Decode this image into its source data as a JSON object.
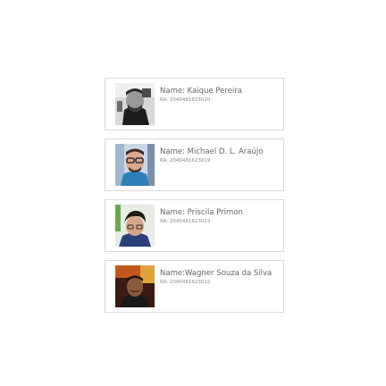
{
  "students": [
    {
      "name_text": "Name: Kaique Pereira",
      "ra_text": "RA: 2040481623020",
      "avatar_icon": "student-photo-icon",
      "photo_tone": "grayscale"
    },
    {
      "name_text": "Name: Michael D. L. Araújo",
      "ra_text": "RA: 2040481623019",
      "avatar_icon": "student-photo-icon",
      "photo_tone": "color"
    },
    {
      "name_text": "Name: Priscila Primon",
      "ra_text": "RA: 2040481623023",
      "avatar_icon": "student-photo-icon",
      "photo_tone": "color"
    },
    {
      "name_text": "Name:Wagner Souza da Silva",
      "ra_text": "RA: 2040481623032",
      "avatar_icon": "student-photo-icon",
      "photo_tone": "color"
    }
  ],
  "colors": {
    "card_border": "#d9d9d9",
    "name_text": "#666666",
    "ra_text": "#8a8a8a"
  }
}
